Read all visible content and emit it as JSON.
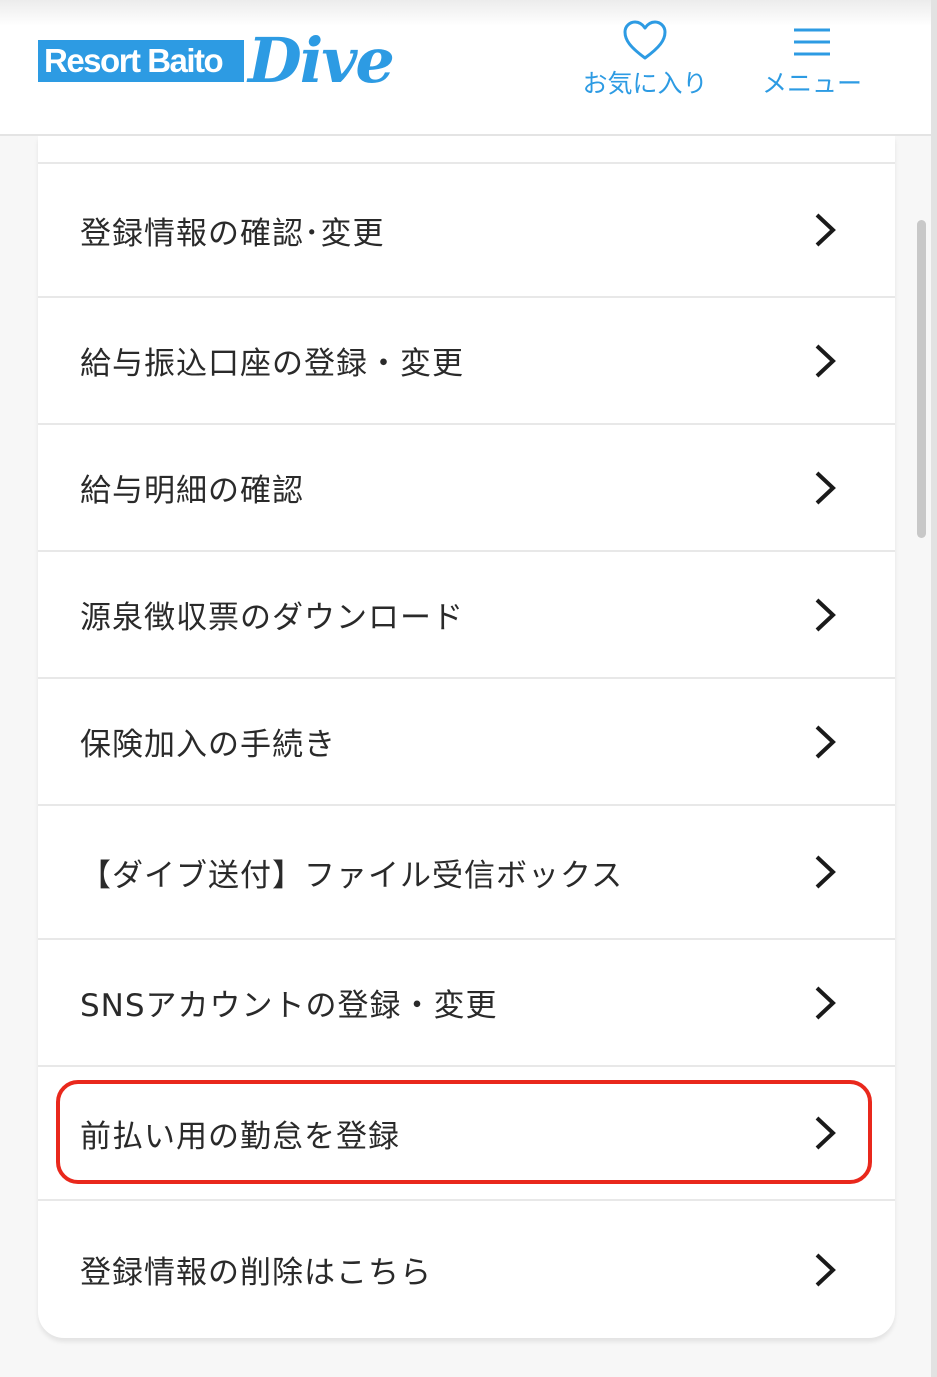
{
  "header": {
    "logo_box_text": "Resort Baito",
    "logo_script_text": "Dive",
    "favorites_label": "お気に入り",
    "menu_label": "メニュー",
    "brand_color": "#2d9be3"
  },
  "menu_items": [
    {
      "label": "登録情報の確認･変更",
      "icon": "chevron-right-icon"
    },
    {
      "label": "給与振込口座の登録・変更",
      "icon": "chevron-right-icon"
    },
    {
      "label": "給与明細の確認",
      "icon": "chevron-right-icon"
    },
    {
      "label": "源泉徴収票のダウンロード",
      "icon": "chevron-right-icon"
    },
    {
      "label": "保険加入の手続き",
      "icon": "chevron-right-icon"
    },
    {
      "label": "【ダイブ送付】ファイル受信ボックス",
      "icon": "chevron-right-icon"
    },
    {
      "label": "SNSアカウントの登録・変更",
      "icon": "chevron-right-icon"
    },
    {
      "label": "前払い用の勤怠を登録",
      "icon": "chevron-right-icon",
      "highlighted": true
    },
    {
      "label": "登録情報の削除はこちら",
      "icon": "chevron-right-icon"
    }
  ],
  "highlight_color": "#e9281c"
}
